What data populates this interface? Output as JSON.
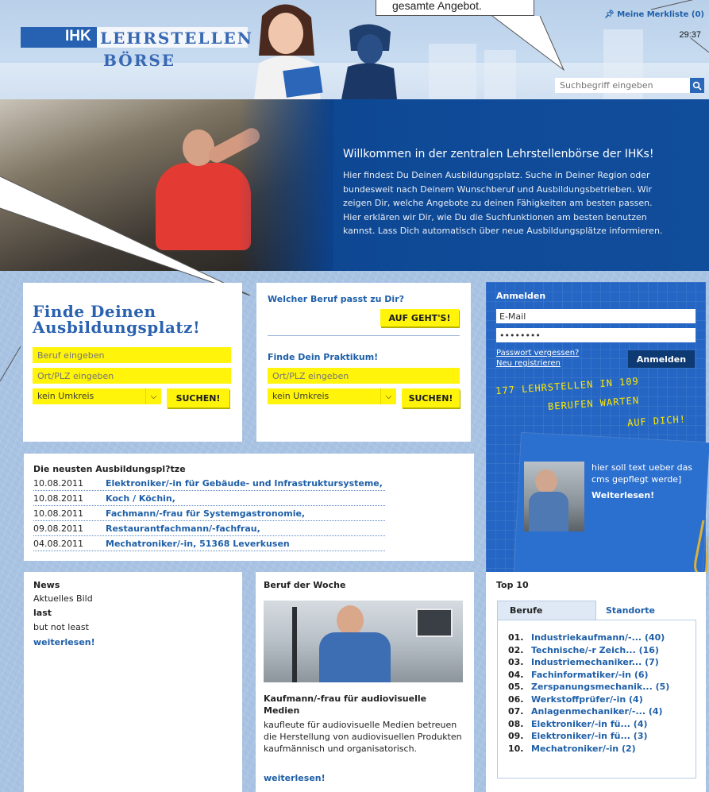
{
  "header": {
    "callout_text": "gesamte Angebot.",
    "logo_ihk": "IHK",
    "logo_line1": "LEHRSTELLEN",
    "logo_line2": "BÖRSE",
    "merkliste_label": "Meine Merkliste (0)",
    "timer": "29:37",
    "search_placeholder": "Suchbegriff eingeben"
  },
  "hero": {
    "title": "Willkommen in der zentralen Lehrstellenbörse der IHKs!",
    "text": "Hier findest Du Deinen Ausbildungsplatz. Suche in Deiner Region oder bundesweit nach Deinem Wunschberuf und Ausbildungsbetrieben. Wir zeigen Dir, welche Angebote zu deinen Fähigkeiten am besten passen. Hier erklären wir Dir, wie Du die Suchfunktionen am besten benutzen kannst. Lass Dich automatisch über neue Ausbildungsplätze informieren."
  },
  "finde": {
    "title_line1": "Finde Deinen",
    "title_line2": "Ausbildungsplatz!",
    "beruf_placeholder": "Beruf eingeben",
    "ort_placeholder": "Ort/PLZ eingeben",
    "umkreis_value": "kein Umkreis",
    "search_label": "SUCHEN!"
  },
  "beruf_panel": {
    "heading": "Welcher Beruf passt zu Dir?",
    "button_label": "AUF GEHT'S!",
    "praktikum_heading": "Finde Dein Praktikum!",
    "ort_placeholder": "Ort/PLZ eingeben",
    "umkreis_value": "kein Umkreis",
    "search_label": "SUCHEN!"
  },
  "login": {
    "heading": "Anmelden",
    "email_value": "E-Mail",
    "password_value": "••••••••",
    "forgot_link": "Passwort vergessen?",
    "register_link": "Neu registrieren",
    "button_label": "Anmelden",
    "chalk_line1": "177 LEHRSTELLEN IN 109",
    "chalk_line2": "BERUFEN WARTEN",
    "chalk_line3": "AUF DICH!",
    "teaser_text": "hier soll text ueber das cms gepflegt werde]",
    "teaser_link": "Weiterlesen!"
  },
  "latest": {
    "heading": "Die neusten Ausbildungspl?tze",
    "items": [
      {
        "date": "10.08.2011",
        "title": "Elektroniker/-in für Gebäude- und Infrastruktursysteme,"
      },
      {
        "date": "10.08.2011",
        "title": "Koch / Köchin,"
      },
      {
        "date": "10.08.2011",
        "title": "Fachmann/-frau für Systemgastronomie,"
      },
      {
        "date": "09.08.2011",
        "title": "Restaurantfachmann/-fachfrau,"
      },
      {
        "date": "04.08.2011",
        "title": "Mechatroniker/-in, 51368 Leverkusen"
      }
    ]
  },
  "news": {
    "heading": "News",
    "line1": "Aktuelles Bild",
    "line2": "last",
    "line3": "but not least",
    "link": "weiterlesen!"
  },
  "beruf_woche": {
    "heading": "Beruf der Woche",
    "title": "Kaufmann/-frau für audiovisuelle Medien",
    "text": "kaufleute für audiovisuelle Medien betreuen die Herstellung von audiovisuellen Produkten kaufmännisch und organisatorisch.",
    "link": "weiterlesen!"
  },
  "top10": {
    "heading": "Top 10",
    "tab_berufe": "Berufe",
    "tab_standorte": "Standorte",
    "items": [
      {
        "rank": "01.",
        "label": "Industriekaufmann/-... (40)"
      },
      {
        "rank": "02.",
        "label": "Technische/-r Zeich... (16)"
      },
      {
        "rank": "03.",
        "label": "Industriemechaniker... (7)"
      },
      {
        "rank": "04.",
        "label": "Fachinformatiker/-in (6)"
      },
      {
        "rank": "05.",
        "label": "Zerspanungsmechanik... (5)"
      },
      {
        "rank": "06.",
        "label": "Werkstoffprüfer/-in (4)"
      },
      {
        "rank": "07.",
        "label": "Anlagenmechaniker/-... (4)"
      },
      {
        "rank": "08.",
        "label": "Elektroniker/-in fü... (4)"
      },
      {
        "rank": "09.",
        "label": "Elektroniker/-in fü... (3)"
      },
      {
        "rank": "10.",
        "label": "Mechatroniker/-in (2)"
      }
    ]
  },
  "colors": {
    "brand_blue": "#1e5fa8",
    "login_blue": "#2566c4",
    "hero_blue": "#0f4a97",
    "highlight_yellow": "#fff40a"
  },
  "icons": {
    "search": "search-icon",
    "pin": "pin-icon",
    "dropdown": "chevron-down-icon"
  }
}
